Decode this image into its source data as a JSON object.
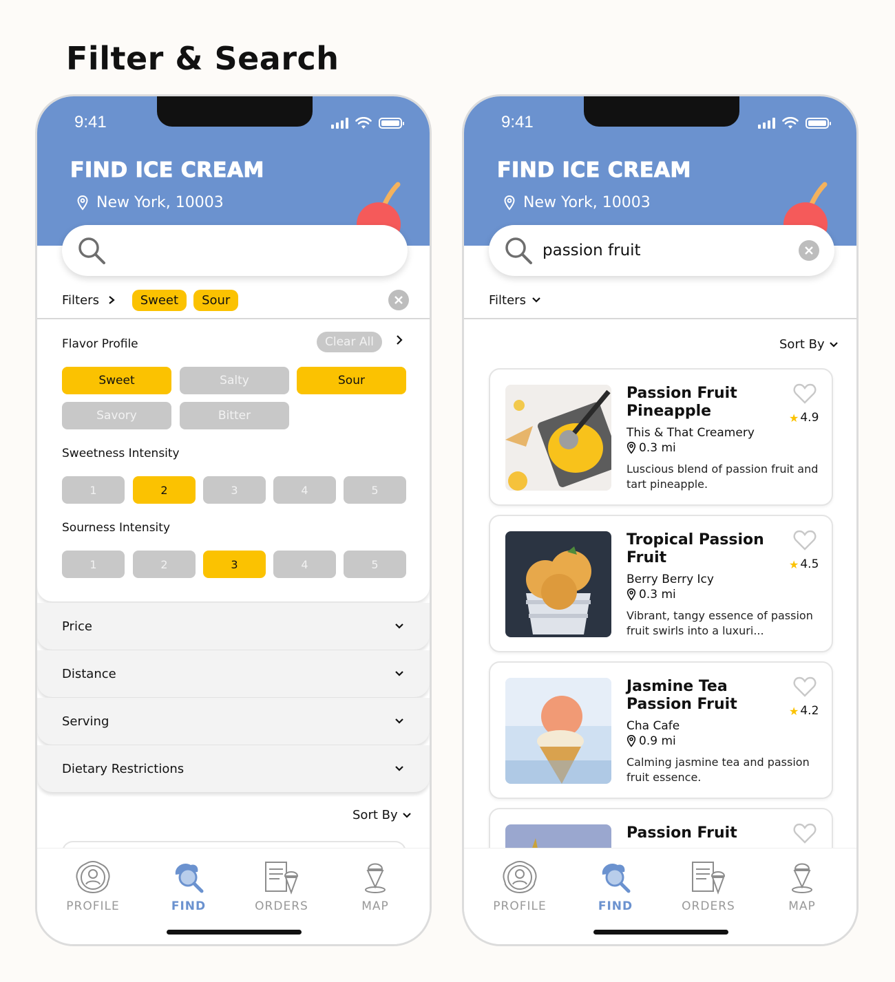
{
  "page_title": "Filter & Search",
  "colors": {
    "header": "#6b92cf",
    "accent": "#fbc201",
    "inactive": "#c8c8c8"
  },
  "left": {
    "status_time": "9:41",
    "app_title": "FIND ICE CREAM",
    "location": "New York, 10003",
    "search_value": "",
    "filters_label": "Filters",
    "active_chips": [
      "Sweet",
      "Sour"
    ],
    "flavor_profile": {
      "label": "Flavor Profile",
      "clear_all": "Clear All",
      "options": [
        {
          "label": "Sweet",
          "selected": true
        },
        {
          "label": "Salty",
          "selected": false
        },
        {
          "label": "Sour",
          "selected": true
        },
        {
          "label": "Savory",
          "selected": false
        },
        {
          "label": "Bitter",
          "selected": false
        }
      ]
    },
    "sweetness": {
      "label": "Sweetness Intensity",
      "levels": [
        "1",
        "2",
        "3",
        "4",
        "5"
      ],
      "selected": "2"
    },
    "sourness": {
      "label": "Sourness Intensity",
      "levels": [
        "1",
        "2",
        "3",
        "4",
        "5"
      ],
      "selected": "3"
    },
    "accordions": [
      "Price",
      "Distance",
      "Serving",
      "Dietary Restrictions"
    ],
    "sort_by": "Sort By"
  },
  "right": {
    "status_time": "9:41",
    "app_title": "FIND ICE CREAM",
    "location": "New York, 10003",
    "search_value": "passion fruit",
    "filters_label": "Filters",
    "sort_by": "Sort By",
    "results": [
      {
        "title": "Passion Fruit Pineapple",
        "rating": "4.9",
        "shop": "This & That Creamery",
        "distance": "0.3 mi",
        "desc": "Luscious blend of passion fruit and tart pineapple."
      },
      {
        "title": "Tropical Passion Fruit",
        "rating": "4.5",
        "shop": "Berry Berry Icy",
        "distance": "0.3 mi",
        "desc": "Vibrant, tangy essence of passion fruit swirls into a luxuri..."
      },
      {
        "title": "Jasmine Tea Passion Fruit",
        "rating": "4.2",
        "shop": "Cha Cafe",
        "distance": "0.9 mi",
        "desc": "Calming jasmine tea and passion fruit essence."
      },
      {
        "title": "Passion Fruit"
      }
    ]
  },
  "tabs": [
    {
      "label": "PROFILE",
      "icon": "profile-icon",
      "active": false
    },
    {
      "label": "FIND",
      "icon": "find-icon",
      "active": true
    },
    {
      "label": "ORDERS",
      "icon": "orders-icon",
      "active": false
    },
    {
      "label": "MAP",
      "icon": "map-icon",
      "active": false
    }
  ]
}
